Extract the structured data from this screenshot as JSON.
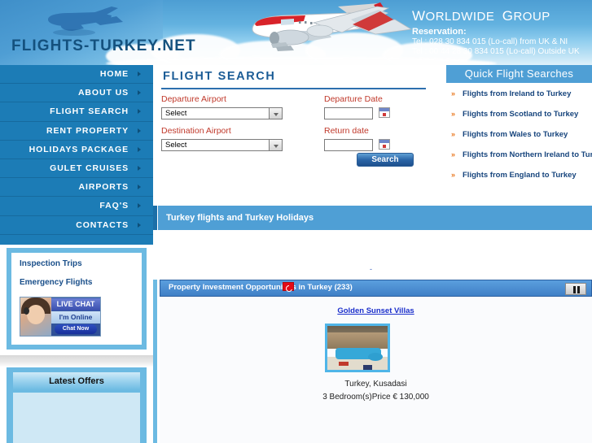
{
  "header": {
    "logo_text": "FLIGHTS-TURKEY.NET",
    "brand_worldwide": "ORLDWIDE",
    "brand_w": "W",
    "brand_group": "ROUP",
    "brand_g": "G",
    "reservation_label": "Reservation:",
    "tel_uk_ni": "Tel : 028 30 834 015 (Lo-call) from UK & NI",
    "tel_outside_uk": "Tel : 00 44 28 30 834 015 (Lo-call) Outside UK"
  },
  "nav": {
    "items": [
      {
        "label": "HOME"
      },
      {
        "label": "ABOUT US"
      },
      {
        "label": "FLIGHT SEARCH"
      },
      {
        "label": "RENT PROPERTY"
      },
      {
        "label": "HOLIDAYS PACKAGE"
      },
      {
        "label": "GULET CRUISES"
      },
      {
        "label": "AIRPORTS"
      },
      {
        "label": "FAQ'S"
      },
      {
        "label": "CONTACTS"
      }
    ]
  },
  "sidebar": {
    "inspection_trips": "Inspection Trips",
    "emergency_flights": "Emergency Flights",
    "chat": {
      "title": "LIVE CHAT",
      "status": "I'm Online",
      "button": "Chat Now"
    },
    "latest_offers_title": "Latest Offers"
  },
  "flight_search": {
    "title": "FLIGHT SEARCH",
    "departure_airport_label": "Departure Airport",
    "departure_airport_value": "Select",
    "destination_airport_label": "Destination Airport",
    "destination_airport_value": "Select",
    "departure_date_label": "Departure Date",
    "departure_date_value": "",
    "return_date_label": "Return date",
    "return_date_value": "",
    "search_button": "Search"
  },
  "quick_searches": {
    "title": "Quick Flight Searches",
    "marker": "»",
    "links": [
      {
        "label": "Flights from Ireland to Turkey"
      },
      {
        "label": "Flights from Scotland to Turkey"
      },
      {
        "label": "Flights from Wales to Turkey"
      },
      {
        "label": "Flights from Northern Ireland to Turkey"
      },
      {
        "label": "Flights from England to Turkey"
      }
    ]
  },
  "section_bar": {
    "title": "Turkey flights and Turkey Holidays"
  },
  "property_panel": {
    "title": "Property Investment Opportunities in Turkey (233)",
    "pause_tooltip": "Pause",
    "mini_dash": "-",
    "listing": {
      "name": "Golden Sunset Villas",
      "location": "Turkey, Kusadasi",
      "price": "3 Bedroom(s)Price € 130,000"
    }
  },
  "colors": {
    "nav_blue": "#1c7cb6",
    "bar_blue": "#4f9fd5",
    "accent_orange": "#e8761c",
    "label_red": "#c0392b",
    "link_blue": "#17457d",
    "panel_blue": "#6cbae2"
  }
}
